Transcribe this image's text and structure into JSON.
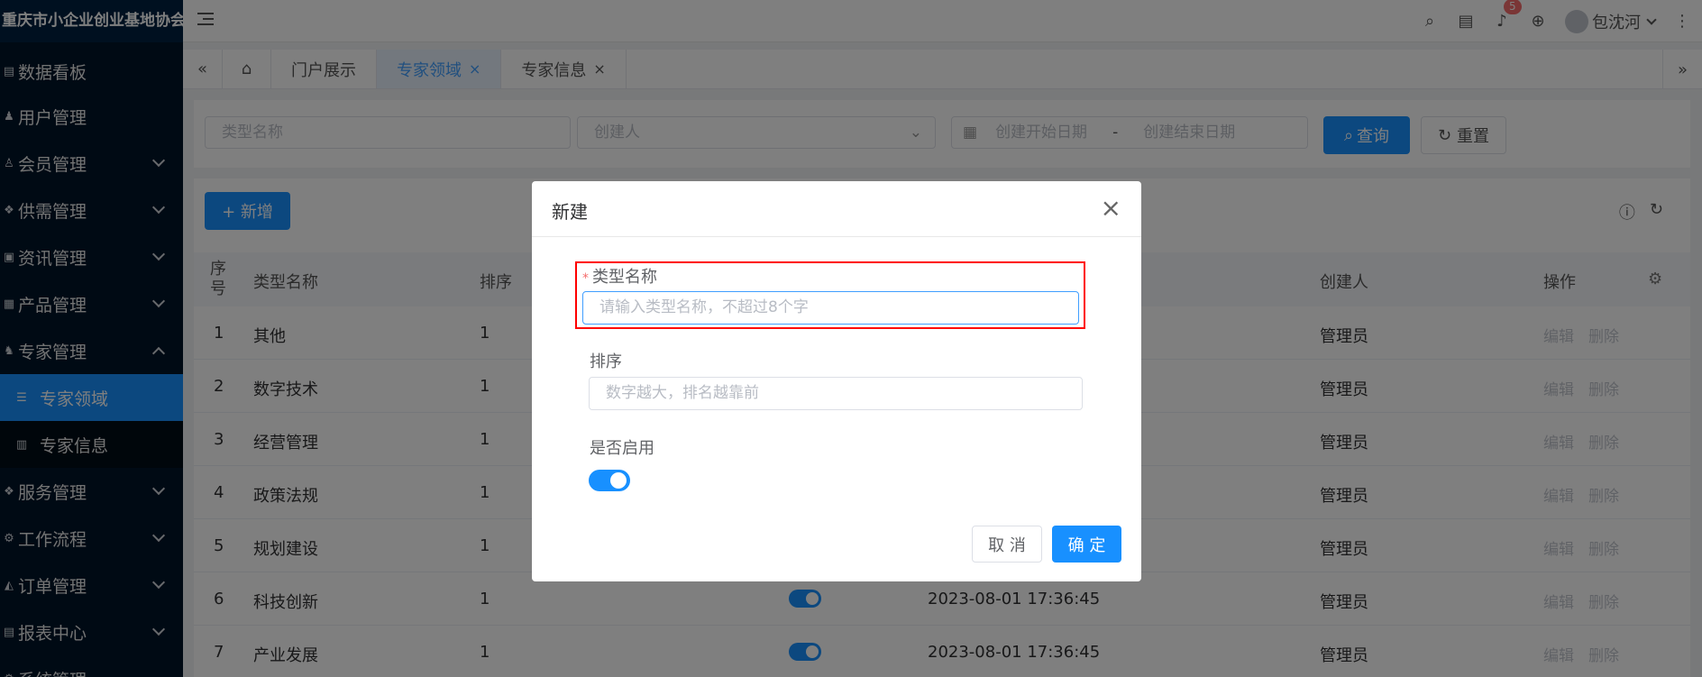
{
  "sidebar": {
    "title": "重庆市小企业创业基地协会",
    "items": [
      {
        "label": "数据看板"
      },
      {
        "label": "用户管理"
      },
      {
        "label": "会员管理"
      },
      {
        "label": "供需管理"
      },
      {
        "label": "资讯管理"
      },
      {
        "label": "产品管理"
      },
      {
        "label": "专家管理"
      },
      {
        "label": "专家领域"
      },
      {
        "label": "专家信息"
      },
      {
        "label": "服务管理"
      },
      {
        "label": "工作流程"
      },
      {
        "label": "订单管理"
      },
      {
        "label": "报表中心"
      },
      {
        "label": "系统管理"
      }
    ]
  },
  "header": {
    "notification_count": "5",
    "username": "包沈河"
  },
  "tabs": [
    {
      "label": "门户展示"
    },
    {
      "label": "专家领域"
    },
    {
      "label": "专家信息"
    }
  ],
  "search": {
    "type_name_placeholder": "类型名称",
    "creator_placeholder": "创建人",
    "start_date_placeholder": "创建开始日期",
    "date_separator": "-",
    "end_date_placeholder": "创建结束日期",
    "query_label": "查询",
    "reset_label": "重置"
  },
  "table": {
    "add_label": "+ 新增",
    "columns": {
      "index": "序号",
      "type_name": "类型名称",
      "sort": "排序",
      "creator": "创建人",
      "action": "操作"
    },
    "edit_label": "编辑",
    "delete_label": "删除",
    "rows": [
      {
        "index": "1",
        "name": "其他",
        "sort": "1",
        "created": "",
        "creator": "管理员"
      },
      {
        "index": "2",
        "name": "数字技术",
        "sort": "1",
        "created": "",
        "creator": "管理员"
      },
      {
        "index": "3",
        "name": "经营管理",
        "sort": "1",
        "created": "",
        "creator": "管理员"
      },
      {
        "index": "4",
        "name": "政策法规",
        "sort": "1",
        "created": "",
        "creator": "管理员"
      },
      {
        "index": "5",
        "name": "规划建设",
        "sort": "1",
        "created": "",
        "creator": "管理员"
      },
      {
        "index": "6",
        "name": "科技创新",
        "sort": "1",
        "created": "2023-08-01 17:36:45",
        "creator": "管理员"
      },
      {
        "index": "7",
        "name": "产业发展",
        "sort": "1",
        "created": "2023-08-01 17:36:45",
        "creator": "管理员"
      }
    ]
  },
  "dialog": {
    "title": "新建",
    "required_mark": "*",
    "type_name_label": "类型名称",
    "type_name_placeholder": "请输入类型名称，不超过8个字",
    "sort_label": "排序",
    "sort_placeholder": "数字越大，排名越靠前",
    "enabled_label": "是否启用",
    "enabled": true,
    "cancel_label": "取 消",
    "confirm_label": "确 定"
  }
}
